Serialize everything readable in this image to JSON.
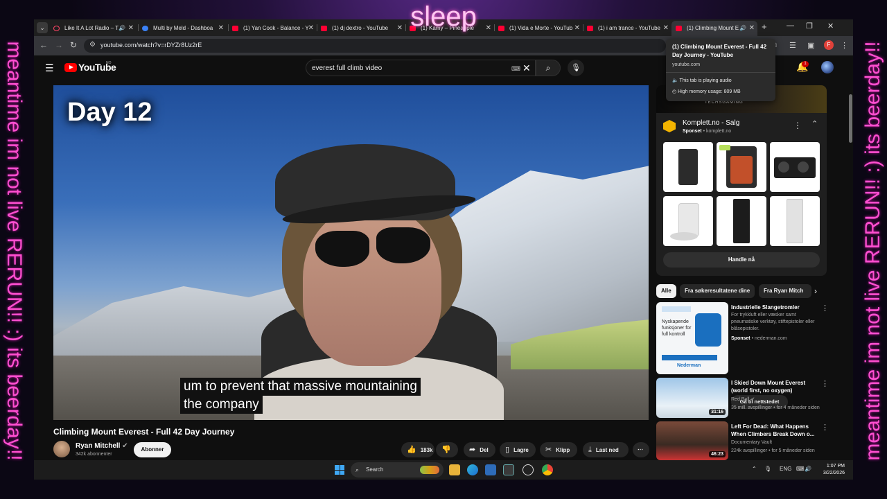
{
  "overlay": {
    "top_text": "sleep",
    "side_text_left": "meantime im not live RERUN!! :) its beerday!!",
    "side_text_right": "meantime im not live RERUN!! :) its beerday!!"
  },
  "browser": {
    "tabs": [
      {
        "title": "Like It A Lot Radio – T"
      },
      {
        "title": "Multi by Meld - Dashboa"
      },
      {
        "title": "(1) Yan Cook - Balance - Y"
      },
      {
        "title": "(1) dj dextro - YouTube"
      },
      {
        "title": "(1) Kamy – Pineapple"
      },
      {
        "title": "(1) Vida e Morte - YouTub"
      },
      {
        "title": "(1) i am trance - YouTube"
      },
      {
        "title": "(1) Climbing Mount E"
      }
    ],
    "url": "youtube.com/watch?v=rDYZr8Uz2rE",
    "profile_initial": "F",
    "hover_card": {
      "title": "(1) Climbing Mount Everest - Full 42 Day Journey - YouTube",
      "domain": "youtube.com",
      "audio": "This tab is playing audio",
      "memory": "High memory usage: 809 MB"
    }
  },
  "youtube": {
    "logo_text": "YouTube",
    "logo_country": "NO",
    "search_query": "everest full climb video",
    "create_label": "ett",
    "notifications": "1",
    "video": {
      "day_label": "Day 12",
      "caption_lines": [
        "um to prevent that massive mountaining",
        "the company"
      ],
      "title": "Climbing Mount Everest - Full 42 Day Journey",
      "channel": "Ryan Mitchell",
      "subscribers": "342k abonnenter",
      "subscribe_label": "Abonner",
      "likes": "183k",
      "share": "Del",
      "save": "Lagre",
      "clip": "Klipp",
      "download": "Last ned"
    },
    "ad": {
      "banner_text": "TECHSGAMING",
      "name": "Komplett.no - Salg",
      "sponsored": "Sponset",
      "domain": "komplett.no",
      "cta": "Handle nå"
    },
    "chips": [
      "Alle",
      "Fra søkeresultatene dine",
      "Fra Ryan Mitch"
    ],
    "recommendations": [
      {
        "title": "Industrielle Slangetromler",
        "desc": "For trykkluft eller væsker samt pneumatiske verktøy, stiftepistoler eller blåsepistoler.",
        "sponsored": "Sponset",
        "domain": "nederman.com",
        "cta": "Gå til nettstedet",
        "thumb_text": "Nyskapende funksjoner for full kontroll",
        "thumb_brand": "Nederman"
      },
      {
        "title": "I Skied Down Mount Everest (world first, no oxygen)",
        "channel": "Red Bull",
        "meta": "35 mill. avspillinger • for 4 måneder siden",
        "duration": "31:16"
      },
      {
        "title": "Left For Dead: What Happens When Climbers Break Down o...",
        "channel": "Documentary Vault",
        "meta": "224k avspillinger • for 5 måneder siden",
        "duration": "46:23"
      }
    ]
  },
  "taskbar": {
    "search_label": "Search",
    "language": "ENG",
    "time": "1:07 PM",
    "date": "3/22/2026"
  }
}
